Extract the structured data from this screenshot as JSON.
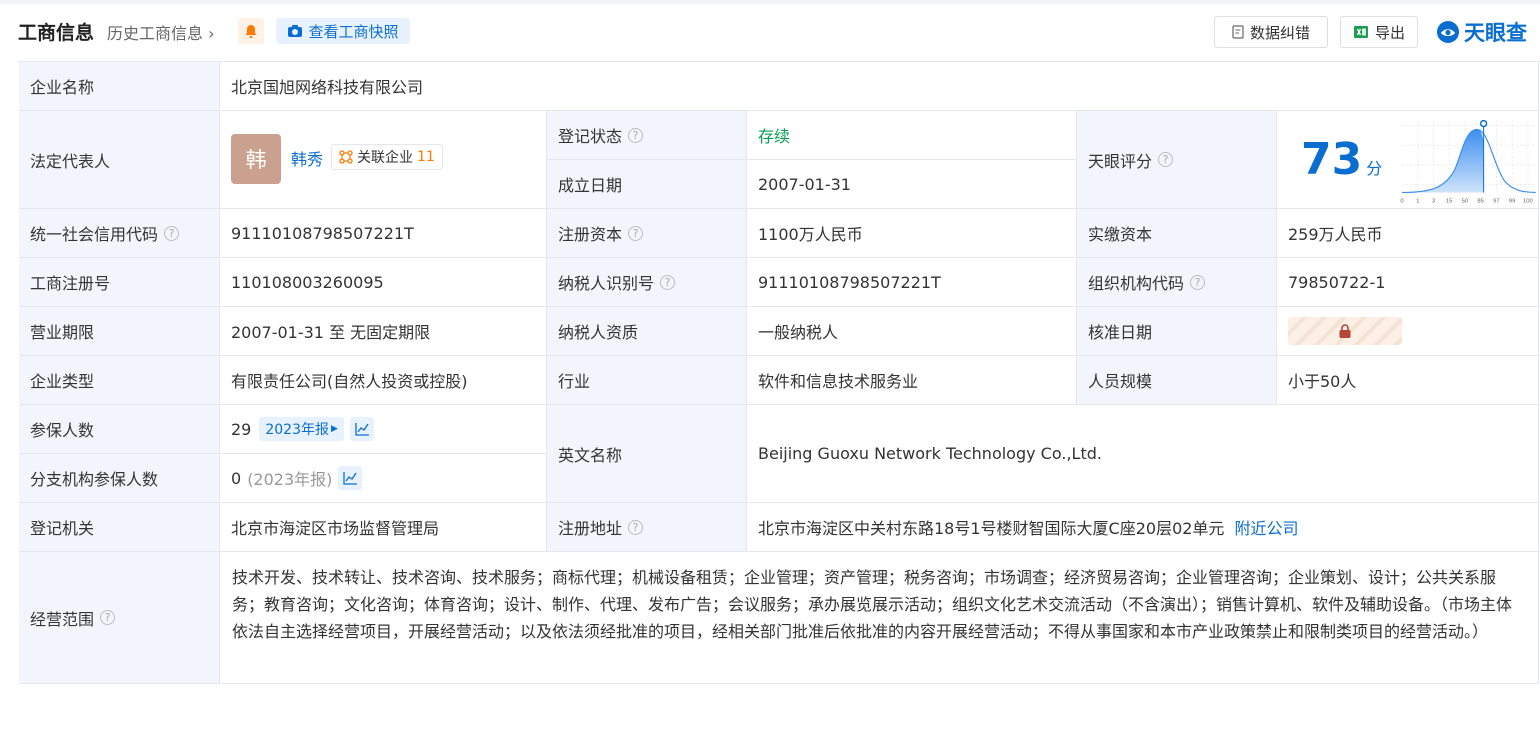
{
  "header": {
    "title": "工商信息",
    "history": "历史工商信息",
    "snapshot": "查看工商快照",
    "correct": "数据纠错",
    "export": "导出",
    "logo": "天眼查"
  },
  "labels": {
    "company_name": "企业名称",
    "legal_rep": "法定代表人",
    "reg_status": "登记状态",
    "found_date": "成立日期",
    "tianyan_score": "天眼评分",
    "credit_code": "统一社会信用代码",
    "reg_capital": "注册资本",
    "paid_capital": "实缴资本",
    "reg_no": "工商注册号",
    "taxpayer_id": "纳税人识别号",
    "org_code": "组织机构代码",
    "biz_term": "营业期限",
    "taxpayer_qual": "纳税人资质",
    "approve_date": "核准日期",
    "company_type": "企业类型",
    "industry": "行业",
    "staff_size": "人员规模",
    "insured": "参保人数",
    "branch_insured": "分支机构参保人数",
    "english_name": "英文名称",
    "reg_authority": "登记机关",
    "reg_address": "注册地址",
    "biz_scope": "经营范围"
  },
  "values": {
    "company_name": "北京国旭网络科技有限公司",
    "legal_rep_avatar": "韩",
    "legal_rep_name": "韩秀",
    "related_label": "关联企业",
    "related_count": "11",
    "reg_status": "存续",
    "found_date": "2007-01-31",
    "score": "73",
    "score_unit": "分",
    "score_axis": [
      "0",
      "1",
      "3",
      "15",
      "50",
      "85",
      "97",
      "99",
      "100"
    ],
    "credit_code": "91110108798507221T",
    "reg_capital": "1100万人民币",
    "paid_capital": "259万人民币",
    "reg_no": "110108003260095",
    "taxpayer_id": "91110108798507221T",
    "org_code": "79850722-1",
    "biz_term": "2007-01-31 至 无固定期限",
    "taxpayer_qual": "一般纳税人",
    "company_type": "有限责任公司(自然人投资或控股)",
    "industry": "软件和信息技术服务业",
    "staff_size": "小于50人",
    "insured": "29",
    "insured_report": "2023年报",
    "branch_insured": "0",
    "branch_report": "(2023年报)",
    "english_name": "Beijing Guoxu Network Technology Co.,Ltd.",
    "reg_authority": "北京市海淀区市场监督管理局",
    "reg_address": "北京市海淀区中关村东路18号1号楼财智国际大厦C座20层02单元",
    "nearby": "附近公司",
    "biz_scope": "技术开发、技术转让、技术咨询、技术服务；商标代理；机械设备租赁；企业管理；资产管理；税务咨询；市场调查；经济贸易咨询；企业管理咨询；企业策划、设计；公共关系服务；教育咨询；文化咨询；体育咨询；设计、制作、代理、发布广告；会议服务；承办展览展示活动；组织文化艺术交流活动（不含演出）；销售计算机、软件及辅助设备。（市场主体依法自主选择经营项目，开展经营活动；以及依法须经批准的项目，经相关部门批准后依批准的内容开展经营活动；不得从事国家和本市产业政策禁止和限制类项目的经营活动。）"
  },
  "colors": {
    "accent": "#0a6ed1",
    "status_green": "#00a150",
    "label_bg": "#f2f6fc",
    "orange": "#ff7a00"
  }
}
